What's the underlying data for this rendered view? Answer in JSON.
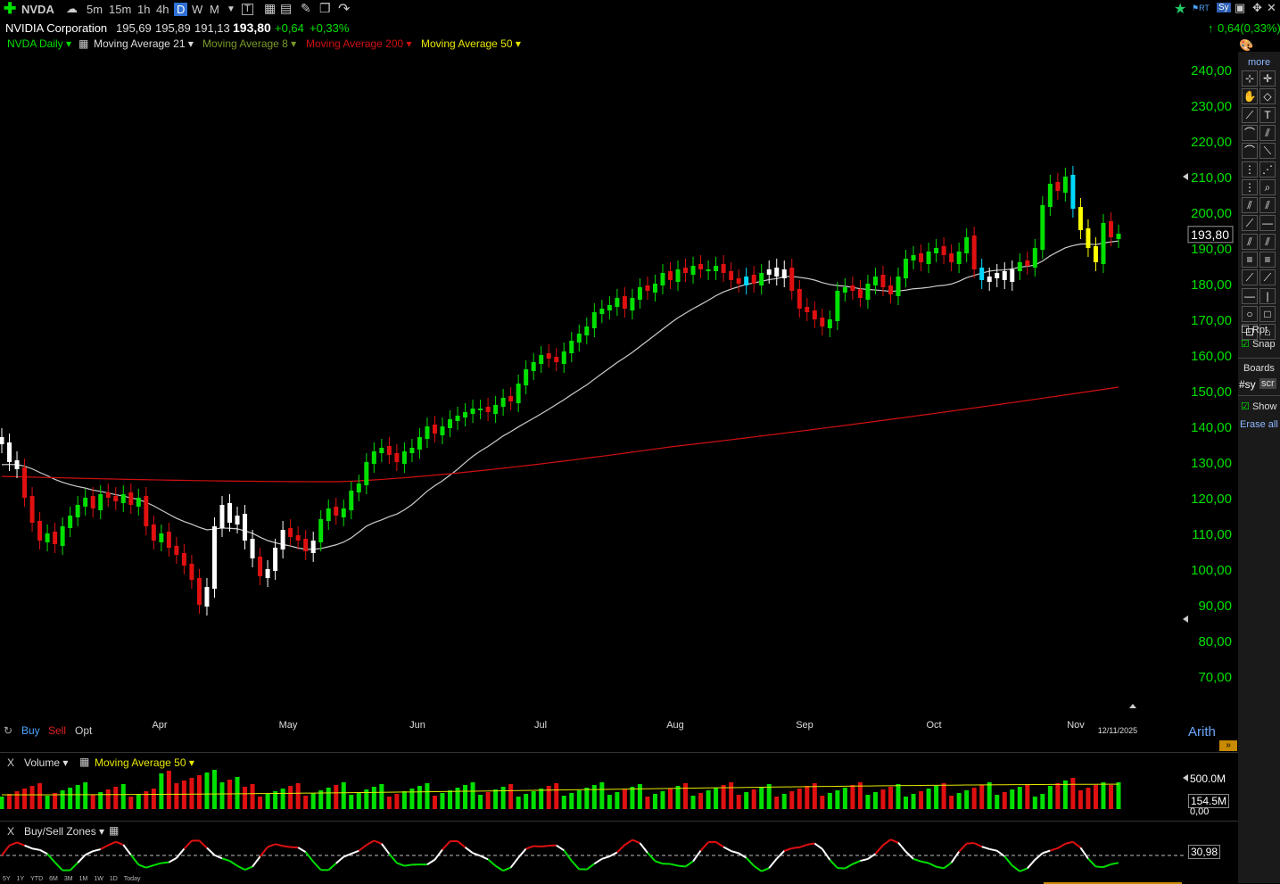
{
  "header": {
    "symbol": "NVDA",
    "timeframes": [
      "5m",
      "15m",
      "1h",
      "4h",
      "D",
      "W",
      "M"
    ],
    "active_timeframe": "D"
  },
  "quote": {
    "name": "NVIDIA Corporation",
    "open": "195,69",
    "high": "195,89",
    "low": "191,13",
    "last": "193,80",
    "change": "+0,64",
    "change_pct": "+0,33%",
    "right_change": "0,64(0,33%)"
  },
  "studies": {
    "main": "NVDA Daily",
    "ma21": "Moving Average 21",
    "ma8": "Moving Average 8",
    "ma200": "Moving Average 200",
    "ma50": "Moving Average 50"
  },
  "colors": {
    "up": "#00e000",
    "down": "#e01010",
    "neutral": "#ffffff",
    "ma21": "#cccccc",
    "ma200": "#d01010",
    "ma50": "#e8e800",
    "ma8": "#7a9a2a",
    "cyan": "#00d8ff",
    "yellow_bar": "#ffff00"
  },
  "chart_data": {
    "type": "candlestick",
    "ylim": [
      65,
      245
    ],
    "y_ticks": [
      "240,00",
      "230,00",
      "220,00",
      "210,00",
      "200,00",
      "190,00",
      "180,00",
      "170,00",
      "160,00",
      "150,00",
      "140,00",
      "130,00",
      "120,00",
      "110,00",
      "100,00",
      "90,00",
      "80,00",
      "70,00"
    ],
    "months": [
      "Apr",
      "May",
      "Jun",
      "Jul",
      "Aug",
      "Sep",
      "Oct",
      "Nov"
    ],
    "date_label": "12/11/2025",
    "last_price": "193,80",
    "scale": "Arith",
    "closes": [
      135,
      130,
      128,
      120,
      113,
      108,
      110,
      107,
      112,
      115,
      118,
      120,
      117,
      121,
      120,
      119,
      121,
      118,
      120,
      112,
      108,
      110,
      106,
      104,
      101,
      97,
      90,
      95,
      112,
      118,
      113,
      115,
      108,
      103,
      98,
      100,
      106,
      111,
      109,
      108,
      105,
      108,
      114,
      117,
      115,
      117,
      122,
      124,
      130,
      133,
      134,
      132,
      130,
      133,
      134,
      137,
      140,
      138,
      140,
      142,
      143,
      144,
      145,
      145,
      144,
      146,
      148,
      147,
      152,
      156,
      158,
      160,
      159,
      158,
      161,
      164,
      166,
      168,
      172,
      173,
      174,
      176,
      173,
      176,
      179,
      178,
      180,
      183,
      181,
      184,
      183,
      185,
      184,
      184,
      185,
      183,
      181,
      180,
      182,
      180,
      183,
      184,
      182,
      184,
      178,
      173,
      172,
      170,
      168,
      170,
      178,
      179,
      178,
      176,
      180,
      182,
      179,
      177,
      182,
      187,
      188,
      186,
      189,
      190,
      188,
      186,
      189,
      193,
      184,
      181,
      182,
      183,
      181,
      184,
      186,
      185,
      190,
      202,
      208,
      206,
      210,
      201,
      195,
      190,
      186,
      197,
      193,
      194
    ],
    "ma21_start": 129,
    "ma200_start": 126,
    "ma200_end": 151
  },
  "order": {
    "buy": "Buy",
    "sell": "Sell",
    "opt": "Opt"
  },
  "volume": {
    "title": "Volume",
    "ma_label": "Moving Average 50",
    "ticks": [
      "500.0M",
      "0,00"
    ],
    "current": "154.5M"
  },
  "bszones": {
    "title": "Buy/Sell Zones",
    "value": "30,98"
  },
  "bottom_timeframes": [
    "5Y",
    "1Y",
    "YTD",
    "6M",
    "3M",
    "1M",
    "1W",
    "1D",
    "Today"
  ],
  "toolbar": {
    "more": "more",
    "rpt": "Rpt",
    "snap": "Snap",
    "boards": "Boards",
    "board_tabs": [
      "#sy",
      "scr"
    ],
    "show": "Show",
    "erase_all": "Erase all"
  }
}
